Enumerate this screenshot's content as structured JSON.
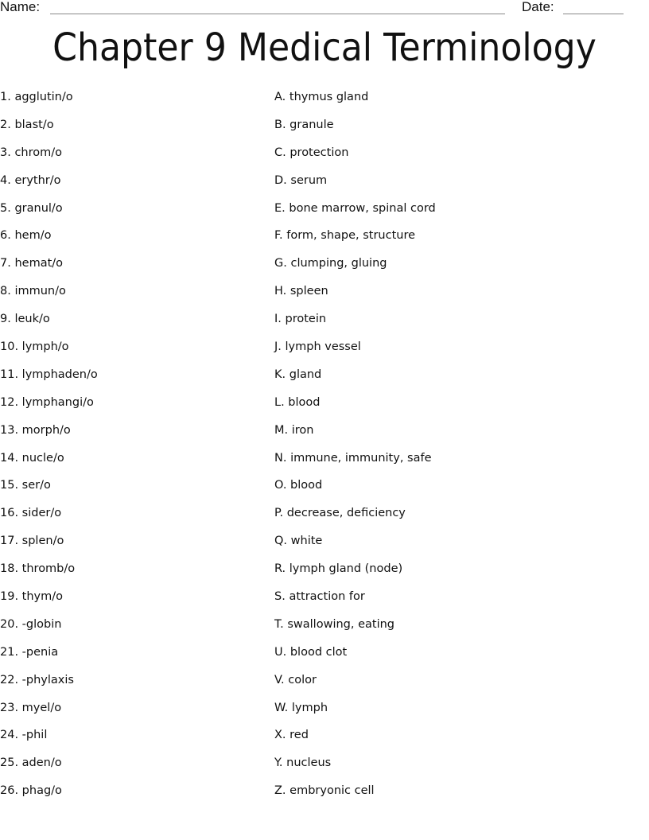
{
  "header": {
    "name_label": "Name:",
    "date_label": "Date:"
  },
  "title": "Chapter 9 Medical Terminology",
  "terms": [
    {
      "number": "1.",
      "text": "agglutin/o"
    },
    {
      "number": "2.",
      "text": "blast/o"
    },
    {
      "number": "3.",
      "text": "chrom/o"
    },
    {
      "number": "4.",
      "text": "erythr/o"
    },
    {
      "number": "5.",
      "text": "granul/o"
    },
    {
      "number": "6.",
      "text": "hem/o"
    },
    {
      "number": "7.",
      "text": "hemat/o"
    },
    {
      "number": "8.",
      "text": "immun/o"
    },
    {
      "number": "9.",
      "text": "leuk/o"
    },
    {
      "number": "10.",
      "text": "lymph/o"
    },
    {
      "number": "11.",
      "text": "lymphaden/o"
    },
    {
      "number": "12.",
      "text": "lymphangi/o"
    },
    {
      "number": "13.",
      "text": "morph/o"
    },
    {
      "number": "14.",
      "text": "nucle/o"
    },
    {
      "number": "15.",
      "text": "ser/o"
    },
    {
      "number": "16.",
      "text": "sider/o"
    },
    {
      "number": "17.",
      "text": "splen/o"
    },
    {
      "number": "18.",
      "text": "thromb/o"
    },
    {
      "number": "19.",
      "text": "thym/o"
    },
    {
      "number": "20.",
      "text": "-globin"
    },
    {
      "number": "21.",
      "text": "-penia"
    },
    {
      "number": "22.",
      "text": "-phylaxis"
    },
    {
      "number": "23.",
      "text": "myel/o"
    },
    {
      "number": "24.",
      "text": "-phil"
    },
    {
      "number": "25.",
      "text": "aden/o"
    },
    {
      "number": "26.",
      "text": "phag/o"
    }
  ],
  "definitions": [
    {
      "letter": "A.",
      "text": "thymus gland"
    },
    {
      "letter": "B.",
      "text": "granule"
    },
    {
      "letter": "C.",
      "text": "protection"
    },
    {
      "letter": "D.",
      "text": "serum"
    },
    {
      "letter": "E.",
      "text": "bone marrow, spinal cord"
    },
    {
      "letter": "F.",
      "text": "form, shape, structure"
    },
    {
      "letter": "G.",
      "text": "clumping, gluing"
    },
    {
      "letter": "H.",
      "text": "spleen"
    },
    {
      "letter": "I.",
      "text": "protein"
    },
    {
      "letter": "J.",
      "text": "lymph vessel"
    },
    {
      "letter": "K.",
      "text": "gland"
    },
    {
      "letter": "L.",
      "text": "blood"
    },
    {
      "letter": "M.",
      "text": "iron"
    },
    {
      "letter": "N.",
      "text": "immune, immunity, safe"
    },
    {
      "letter": "O.",
      "text": "blood"
    },
    {
      "letter": "P.",
      "text": "decrease, deficiency"
    },
    {
      "letter": "Q.",
      "text": "white"
    },
    {
      "letter": "R.",
      "text": "lymph gland (node)"
    },
    {
      "letter": "S.",
      "text": "attraction for"
    },
    {
      "letter": "T.",
      "text": "swallowing, eating"
    },
    {
      "letter": "U.",
      "text": "blood clot"
    },
    {
      "letter": "V.",
      "text": "color"
    },
    {
      "letter": "W.",
      "text": "lymph"
    },
    {
      "letter": "X.",
      "text": "red"
    },
    {
      "letter": "Y.",
      "text": "nucleus"
    },
    {
      "letter": "Z.",
      "text": "embryonic cell"
    }
  ]
}
